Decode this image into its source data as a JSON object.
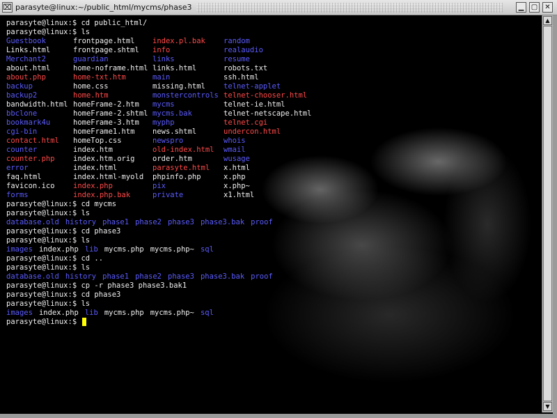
{
  "window": {
    "menu_glyph": "⌧",
    "title": "parasyte@linux:~/public_html/mycms/phase3",
    "minimize_glyph": "▁",
    "maximize_glyph": "▢",
    "close_glyph": "✕"
  },
  "terminal": {
    "lines": [
      {
        "segments": [
          {
            "text": "parasyte@linux:$ cd public_html/",
            "color": "w"
          }
        ]
      },
      {
        "segments": [
          {
            "text": "parasyte@linux:$ ls",
            "color": "w"
          }
        ]
      },
      {
        "cols": [
          {
            "text": "Guestbook",
            "color": "b"
          },
          {
            "text": "frontpage.html",
            "color": "w"
          },
          {
            "text": "index.pl.bak",
            "color": "r"
          },
          {
            "text": "random",
            "color": "b"
          }
        ]
      },
      {
        "cols": [
          {
            "text": "Links.html",
            "color": "w"
          },
          {
            "text": "frontpage.shtml",
            "color": "w"
          },
          {
            "text": "info",
            "color": "r"
          },
          {
            "text": "realaudio",
            "color": "b"
          }
        ]
      },
      {
        "cols": [
          {
            "text": "Merchant2",
            "color": "b"
          },
          {
            "text": "guardian",
            "color": "b"
          },
          {
            "text": "links",
            "color": "b"
          },
          {
            "text": "resume",
            "color": "b"
          }
        ]
      },
      {
        "cols": [
          {
            "text": "about.html",
            "color": "w"
          },
          {
            "text": "home-noframe.html",
            "color": "w"
          },
          {
            "text": "links.html",
            "color": "w"
          },
          {
            "text": "robots.txt",
            "color": "w"
          }
        ]
      },
      {
        "cols": [
          {
            "text": "about.php",
            "color": "r"
          },
          {
            "text": "home-txt.htm",
            "color": "r"
          },
          {
            "text": "main",
            "color": "b"
          },
          {
            "text": "ssh.html",
            "color": "w"
          }
        ]
      },
      {
        "cols": [
          {
            "text": "backup",
            "color": "b"
          },
          {
            "text": "home.css",
            "color": "w"
          },
          {
            "text": "missing.html",
            "color": "w"
          },
          {
            "text": "telnet-applet",
            "color": "b"
          }
        ]
      },
      {
        "cols": [
          {
            "text": "backup2",
            "color": "b"
          },
          {
            "text": "home.htm",
            "color": "r"
          },
          {
            "text": "monstercontrols",
            "color": "b"
          },
          {
            "text": "telnet-chooser.html",
            "color": "r"
          }
        ]
      },
      {
        "cols": [
          {
            "text": "bandwidth.html",
            "color": "w"
          },
          {
            "text": "homeFrame-2.htm",
            "color": "w"
          },
          {
            "text": "mycms",
            "color": "b"
          },
          {
            "text": "telnet-ie.html",
            "color": "w"
          }
        ]
      },
      {
        "cols": [
          {
            "text": "bbclone",
            "color": "b"
          },
          {
            "text": "homeFrame-2.shtml",
            "color": "w"
          },
          {
            "text": "mycms.bak",
            "color": "b"
          },
          {
            "text": "telnet-netscape.html",
            "color": "w"
          }
        ]
      },
      {
        "cols": [
          {
            "text": "bookmark4u",
            "color": "b"
          },
          {
            "text": "homeFrame-3.htm",
            "color": "w"
          },
          {
            "text": "myphp",
            "color": "b"
          },
          {
            "text": "telnet.cgi",
            "color": "r"
          }
        ]
      },
      {
        "cols": [
          {
            "text": "cgi-bin",
            "color": "b"
          },
          {
            "text": "homeFrame1.htm",
            "color": "w"
          },
          {
            "text": "news.shtml",
            "color": "w"
          },
          {
            "text": "undercon.html",
            "color": "r"
          }
        ]
      },
      {
        "cols": [
          {
            "text": "contact.html",
            "color": "r"
          },
          {
            "text": "homeTop.css",
            "color": "w"
          },
          {
            "text": "newspro",
            "color": "b"
          },
          {
            "text": "whois",
            "color": "b"
          }
        ]
      },
      {
        "cols": [
          {
            "text": "counter",
            "color": "b"
          },
          {
            "text": "index.htm",
            "color": "w"
          },
          {
            "text": "old-index.html",
            "color": "r"
          },
          {
            "text": "wmail",
            "color": "b"
          }
        ]
      },
      {
        "cols": [
          {
            "text": "counter.php",
            "color": "r"
          },
          {
            "text": "index.htm.orig",
            "color": "w"
          },
          {
            "text": "order.htm",
            "color": "w"
          },
          {
            "text": "wusage",
            "color": "b"
          }
        ]
      },
      {
        "cols": [
          {
            "text": "error",
            "color": "b"
          },
          {
            "text": "index.html",
            "color": "w"
          },
          {
            "text": "parasyte.html",
            "color": "r"
          },
          {
            "text": "x.html",
            "color": "w"
          }
        ]
      },
      {
        "cols": [
          {
            "text": "faq.html",
            "color": "w"
          },
          {
            "text": "index.html-myold",
            "color": "w"
          },
          {
            "text": "phpinfo.php",
            "color": "w"
          },
          {
            "text": "x.php",
            "color": "w"
          }
        ]
      },
      {
        "cols": [
          {
            "text": "favicon.ico",
            "color": "w"
          },
          {
            "text": "index.php",
            "color": "r"
          },
          {
            "text": "pix",
            "color": "b"
          },
          {
            "text": "x.php~",
            "color": "w"
          }
        ]
      },
      {
        "cols": [
          {
            "text": "forms",
            "color": "b"
          },
          {
            "text": "index.php.bak",
            "color": "r"
          },
          {
            "text": "private",
            "color": "b"
          },
          {
            "text": "x1.html",
            "color": "w"
          }
        ]
      },
      {
        "segments": [
          {
            "text": "parasyte@linux:$ cd mycms",
            "color": "w"
          }
        ]
      },
      {
        "segments": [
          {
            "text": "parasyte@linux:$ ls",
            "color": "w"
          }
        ]
      },
      {
        "segments": [
          {
            "text": "database.old",
            "color": "b"
          },
          {
            "text": "history",
            "color": "b"
          },
          {
            "text": "phase1",
            "color": "b"
          },
          {
            "text": "phase2",
            "color": "b"
          },
          {
            "text": "phase3",
            "color": "b"
          },
          {
            "text": "phase3.bak",
            "color": "b"
          },
          {
            "text": "proof",
            "color": "b"
          }
        ]
      },
      {
        "segments": [
          {
            "text": "parasyte@linux:$ cd phase3",
            "color": "w"
          }
        ]
      },
      {
        "segments": [
          {
            "text": "parasyte@linux:$ ls",
            "color": "w"
          }
        ]
      },
      {
        "segments": [
          {
            "text": "images",
            "color": "b"
          },
          {
            "text": "index.php",
            "color": "w"
          },
          {
            "text": "lib",
            "color": "b"
          },
          {
            "text": "mycms.php",
            "color": "w"
          },
          {
            "text": "mycms.php~",
            "color": "w"
          },
          {
            "text": "sql",
            "color": "b"
          }
        ]
      },
      {
        "segments": [
          {
            "text": "parasyte@linux:$ cd ..",
            "color": "w"
          }
        ]
      },
      {
        "segments": [
          {
            "text": "parasyte@linux:$ ls",
            "color": "w"
          }
        ]
      },
      {
        "segments": [
          {
            "text": "database.old",
            "color": "b"
          },
          {
            "text": "history",
            "color": "b"
          },
          {
            "text": "phase1",
            "color": "b"
          },
          {
            "text": "phase2",
            "color": "b"
          },
          {
            "text": "phase3",
            "color": "b"
          },
          {
            "text": "phase3.bak",
            "color": "b"
          },
          {
            "text": "proof",
            "color": "b"
          }
        ]
      },
      {
        "segments": [
          {
            "text": "parasyte@linux:$ cp -r phase3 phase3.bak1",
            "color": "w"
          }
        ]
      },
      {
        "segments": [
          {
            "text": "parasyte@linux:$ cd phase3",
            "color": "w"
          }
        ]
      },
      {
        "segments": [
          {
            "text": "parasyte@linux:$ ls",
            "color": "w"
          }
        ]
      },
      {
        "segments": [
          {
            "text": "images",
            "color": "b"
          },
          {
            "text": "index.php",
            "color": "w"
          },
          {
            "text": "lib",
            "color": "b"
          },
          {
            "text": "mycms.php",
            "color": "w"
          },
          {
            "text": "mycms.php~",
            "color": "w"
          },
          {
            "text": "sql",
            "color": "b"
          }
        ]
      },
      {
        "segments": [
          {
            "text": "parasyte@linux:$ ",
            "color": "w"
          }
        ],
        "cursor": true
      }
    ]
  },
  "scrollbar": {
    "up_glyph": "▲",
    "down_glyph": "▼"
  },
  "colors": {
    "directory": "#5b5bff",
    "executable": "#ff4848",
    "file": "#f0f0f0",
    "cursor": "#ffff00"
  }
}
